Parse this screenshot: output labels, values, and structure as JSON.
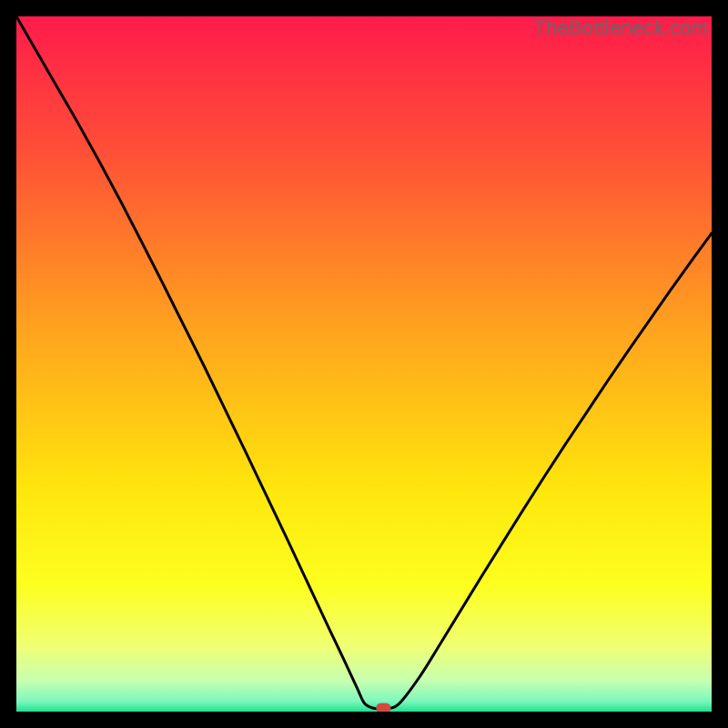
{
  "watermark": "TheBottleneck.com",
  "chart_data": {
    "type": "line",
    "title": "",
    "xlabel": "",
    "ylabel": "",
    "xlim": [
      0,
      100
    ],
    "ylim": [
      0,
      100
    ],
    "grid": false,
    "legend": false,
    "series": [
      {
        "name": "curve",
        "x": [
          0,
          3,
          6,
          9,
          12,
          15,
          18,
          21,
          24,
          27,
          30,
          33,
          36,
          39,
          42,
          45,
          47,
          49,
          50,
          51,
          52,
          53,
          55,
          58,
          61,
          64,
          67,
          70,
          73,
          76,
          79,
          82,
          85,
          88,
          91,
          94,
          97,
          100
        ],
        "values": [
          100,
          94.8,
          89.6,
          84.4,
          79.0,
          73.4,
          67.6,
          61.7,
          55.7,
          49.7,
          43.5,
          37.3,
          31.0,
          24.7,
          18.3,
          11.9,
          7.7,
          3.4,
          1.3,
          0.6,
          0.4,
          0.4,
          1.1,
          5.0,
          9.8,
          14.7,
          19.6,
          24.4,
          29.2,
          33.9,
          38.5,
          43.0,
          47.5,
          51.9,
          56.2,
          60.5,
          64.7,
          68.8
        ]
      }
    ],
    "marker": {
      "x": 52.8,
      "y": 0.5
    },
    "background_gradient": {
      "stops": [
        {
          "offset": 0.0,
          "color": "#ff1b4b"
        },
        {
          "offset": 0.2,
          "color": "#ff5136"
        },
        {
          "offset": 0.45,
          "color": "#ffa31e"
        },
        {
          "offset": 0.68,
          "color": "#ffe60c"
        },
        {
          "offset": 0.82,
          "color": "#fdff1f"
        },
        {
          "offset": 0.905,
          "color": "#f0ff72"
        },
        {
          "offset": 0.955,
          "color": "#c8ffb0"
        },
        {
          "offset": 0.985,
          "color": "#7cf8bc"
        },
        {
          "offset": 1.0,
          "color": "#21e08f"
        }
      ]
    }
  }
}
